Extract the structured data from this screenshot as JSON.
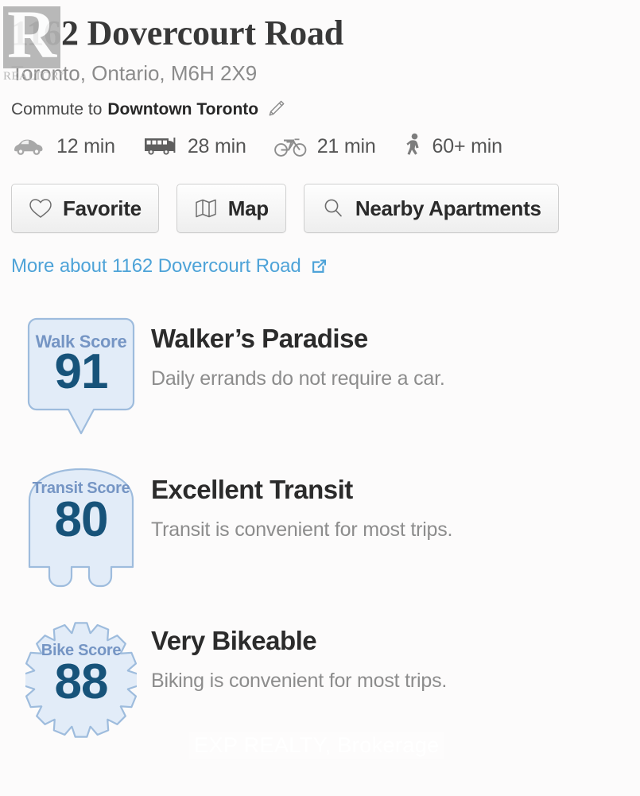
{
  "watermarks": {
    "realtor_letter": "R",
    "realtor_word": "REALTOR",
    "realtor_sup": "®",
    "brokerage": "EXP REALTY, Brokerage"
  },
  "listing": {
    "address_title": "1162 Dovercourt Road",
    "address_sub": "Toronto, Ontario, M6H 2X9"
  },
  "commute": {
    "label": "Commute to",
    "destination": "Downtown Toronto",
    "edit_icon": "pencil-icon",
    "modes": [
      {
        "icon": "car-icon",
        "name": "car",
        "time": "12 min"
      },
      {
        "icon": "bus-icon",
        "name": "transit",
        "time": "28 min"
      },
      {
        "icon": "bicycle-icon",
        "name": "bike",
        "time": "21 min"
      },
      {
        "icon": "pedestrian-icon",
        "name": "walk",
        "time": "60+ min"
      }
    ]
  },
  "actions": [
    {
      "icon": "heart-icon",
      "label": "Favorite"
    },
    {
      "icon": "map-icon",
      "label": "Map"
    },
    {
      "icon": "search-icon",
      "label": "Nearby Apartments"
    }
  ],
  "more_link": {
    "text": "More about 1162 Dovercourt Road",
    "icon": "external-link-icon"
  },
  "scores": [
    {
      "badge_shape": "speech-bubble",
      "badge_label": "Walk Score",
      "score": "91",
      "heading": "Walker’s Paradise",
      "description": "Daily errands do not require a car."
    },
    {
      "badge_shape": "bus",
      "badge_label": "Transit Score",
      "score": "80",
      "heading": "Excellent Transit",
      "description": "Transit is convenient for most trips."
    },
    {
      "badge_shape": "gear",
      "badge_label": "Bike Score",
      "score": "88",
      "heading": "Very Bikeable",
      "description": "Biking is convenient for most trips."
    }
  ],
  "colors": {
    "page_bg": "#fcfbfb",
    "link_blue": "#4ea3d8",
    "badge_fill": "#e2ecf8",
    "badge_stroke": "#9ebcdd",
    "badge_label_blue": "#7595c4",
    "badge_number_navy": "#17537a",
    "heading_dark": "#2b2b2b",
    "muted_gray": "#8c8c8c"
  }
}
